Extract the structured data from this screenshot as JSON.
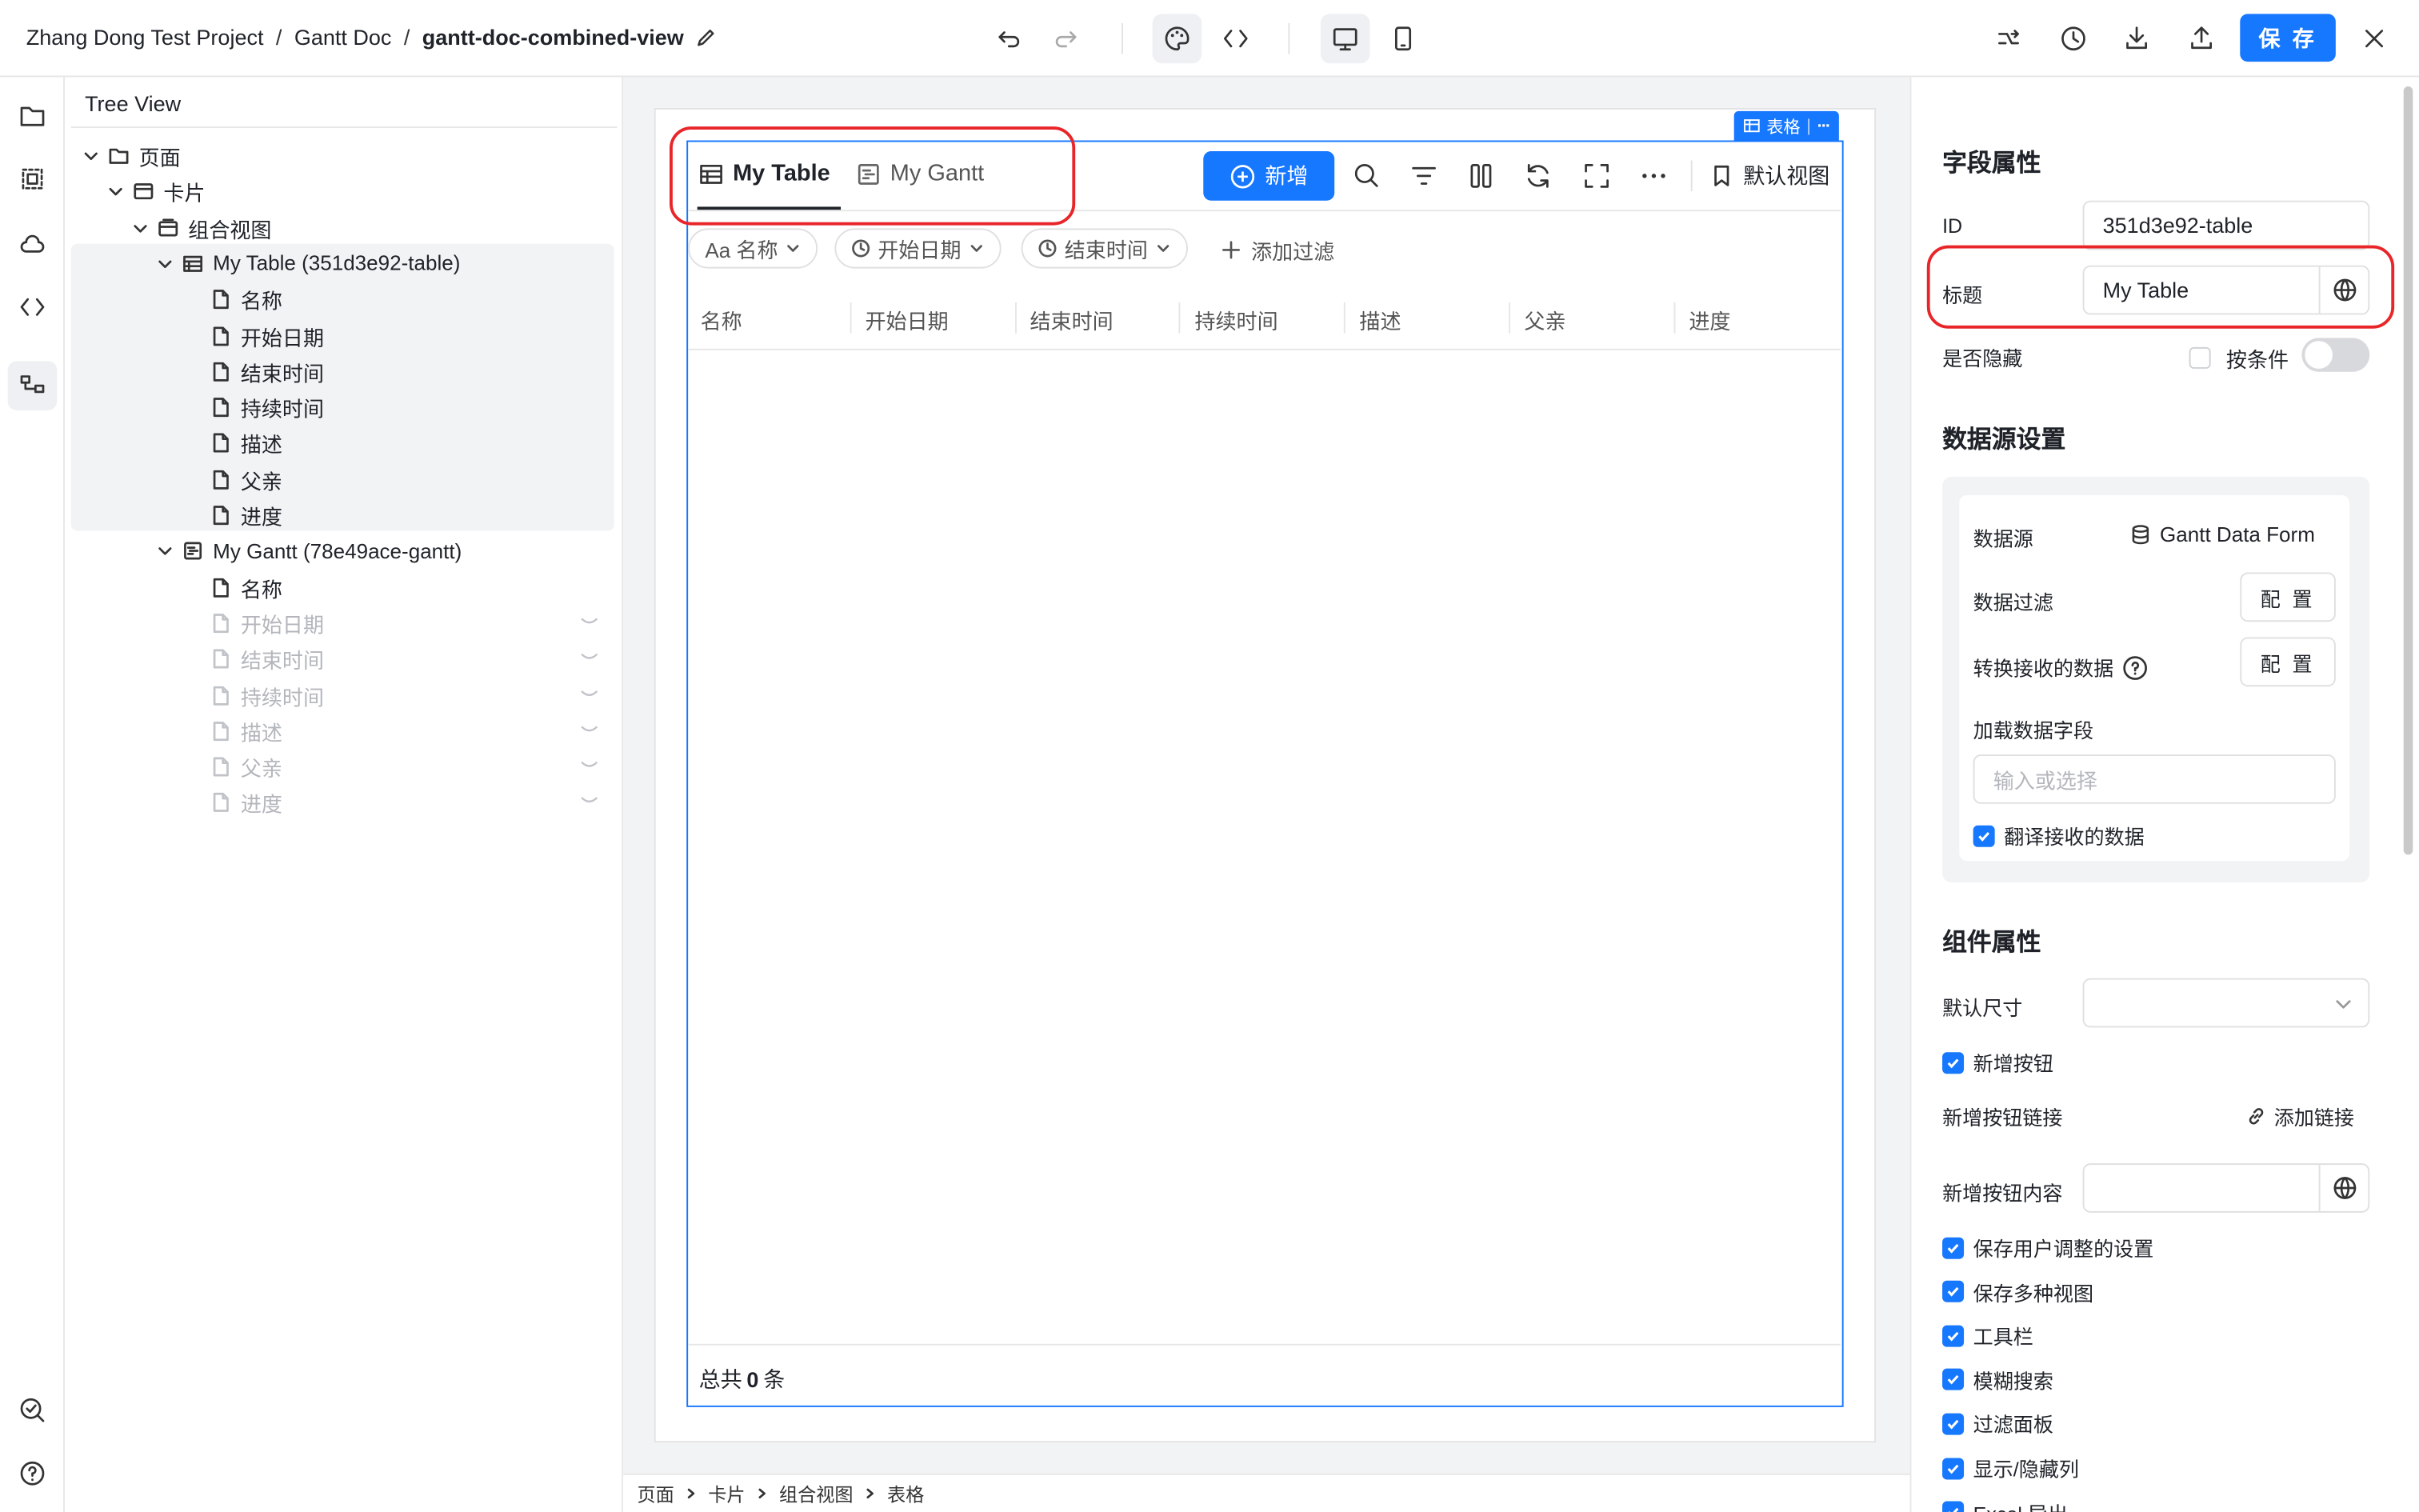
{
  "breadcrumb": {
    "project": "Zhang Dong Test Project",
    "doc": "Gantt Doc",
    "current": "gantt-doc-combined-view",
    "sep": "/"
  },
  "header": {
    "save_label": "保 存"
  },
  "tree": {
    "title": "Tree View",
    "nodes": [
      {
        "label": "页面"
      },
      {
        "label": "卡片"
      },
      {
        "label": "组合视图"
      },
      {
        "label": "My Table (351d3e92-table)"
      },
      {
        "label": "名称"
      },
      {
        "label": "开始日期"
      },
      {
        "label": "结束时间"
      },
      {
        "label": "持续时间"
      },
      {
        "label": "描述"
      },
      {
        "label": "父亲"
      },
      {
        "label": "进度"
      },
      {
        "label": "My Gantt (78e49ace-gantt)"
      },
      {
        "label": "名称"
      },
      {
        "label": "开始日期"
      },
      {
        "label": "结束时间"
      },
      {
        "label": "持续时间"
      },
      {
        "label": "描述"
      },
      {
        "label": "父亲"
      },
      {
        "label": "进度"
      }
    ]
  },
  "component": {
    "tag": "表格",
    "tabs": [
      "My Table",
      "My Gantt"
    ],
    "add_label": "新增",
    "default_view": "默认视图",
    "chips": [
      "Aa 名称",
      "开始日期",
      "结束时间"
    ],
    "add_filter": "添加过滤",
    "columns": [
      "名称",
      "开始日期",
      "结束时间",
      "持续时间",
      "描述",
      "父亲",
      "进度"
    ],
    "total_prefix": "总共",
    "total_count": "0",
    "total_suffix": "条"
  },
  "bottom_breadcrumb": [
    "页面",
    "卡片",
    "组合视图",
    "表格"
  ],
  "props": {
    "section_field": "字段属性",
    "id_label": "ID",
    "id_value": "351d3e92-table",
    "title_label": "标题",
    "title_value": "My Table",
    "hidden_label": "是否隐藏",
    "conditional_label": "按条件",
    "section_ds": "数据源设置",
    "ds_label": "数据源",
    "ds_value": "Gantt Data Form",
    "filter_label": "数据过滤",
    "config_label": "配 置",
    "transform_label": "转换接收的数据",
    "load_fields_label": "加载数据字段",
    "load_fields_placeholder": "输入或选择",
    "translate_label": "翻译接收的数据",
    "section_comp": "组件属性",
    "default_size_label": "默认尺寸",
    "add_button_label": "新增按钮",
    "add_button_link_label": "新增按钮链接",
    "add_link": "添加链接",
    "add_button_content_label": "新增按钮内容",
    "checks": [
      "保存用户调整的设置",
      "保存多种视图",
      "工具栏",
      "模糊搜索",
      "过滤面板",
      "显示/隐藏列",
      "Excel 导出"
    ]
  },
  "colors": {
    "accent": "#1677ff",
    "highlight": "#e8262a"
  }
}
